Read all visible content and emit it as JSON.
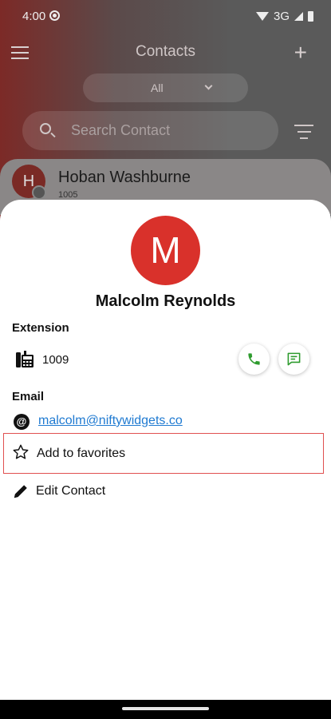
{
  "status_bar": {
    "time": "4:00",
    "network": "3G"
  },
  "background": {
    "title": "Contacts",
    "filter": {
      "selected": "All"
    },
    "search": {
      "placeholder": "Search Contact"
    },
    "contact": {
      "initial": "H",
      "name": "Hoban Washburne",
      "extension": "1005"
    }
  },
  "sheet": {
    "avatar_initial": "M",
    "name": "Malcolm Reynolds",
    "extension_label": "Extension",
    "extension_value": "1009",
    "email_label": "Email",
    "email_value": "malcolm@niftywidgets.co",
    "favorite_label": "Add to favorites",
    "edit_label": "Edit Contact"
  },
  "colors": {
    "accent": "#d9312b",
    "link": "#1f7ad1",
    "call": "#2e9b2e"
  },
  "icons": [
    "menu-icon",
    "plus-icon",
    "chevron-down-icon",
    "search-icon",
    "filter-icon",
    "desk-phone-icon",
    "phone-icon",
    "message-icon",
    "at-icon",
    "star-icon",
    "pencil-icon"
  ]
}
